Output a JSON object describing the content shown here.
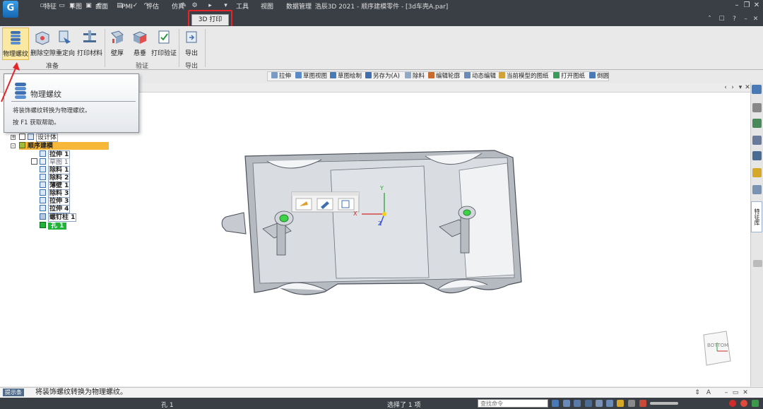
{
  "window": {
    "title": "浩辰3D 2021 - 顺序建模零件 - [3d车壳A.par]",
    "logo_letter": "G"
  },
  "tabs": [
    {
      "label": "特征",
      "active": false
    },
    {
      "label": "草图",
      "active": false
    },
    {
      "label": "曲面",
      "active": false
    },
    {
      "label": "PMI",
      "active": false
    },
    {
      "label": "评估",
      "active": false
    },
    {
      "label": "仿真",
      "active": false
    },
    {
      "label": "3D 打印",
      "active": true
    },
    {
      "label": "工具",
      "active": false
    },
    {
      "label": "视图",
      "active": false
    },
    {
      "label": "数据管理",
      "active": false
    }
  ],
  "ribbon": {
    "groups": [
      {
        "label": "准备",
        "buttons": [
          "物理螺纹",
          "删除空隙",
          "重定向",
          "打印材料"
        ]
      },
      {
        "label": "验证",
        "buttons": [
          "壁厚",
          "悬垂",
          "打印验证"
        ]
      },
      {
        "label": "导出",
        "buttons": [
          "导出"
        ]
      }
    ]
  },
  "tooltip": {
    "title": "物理螺纹",
    "description": "将装饰螺纹转换为物理螺纹。",
    "help": "按 F1 获取帮助。"
  },
  "command_bar": [
    "拉伸",
    "草图视图",
    "草图绘制",
    "另存为(A)",
    "除料",
    "编辑轮廓",
    "动态编辑",
    "当前模型的图纸",
    "打开图纸",
    "倒圆"
  ],
  "tree": {
    "design_body": "设计体",
    "root": "顺序建模",
    "features": [
      "拉伸 1",
      "草图 1",
      "除料 1",
      "除料 2",
      "薄壁 1",
      "除料 3",
      "拉伸 3",
      "拉伸 4",
      "螺钉柱 1",
      "孔 1"
    ]
  },
  "axes": {
    "x": "X",
    "y": "Y",
    "z": "Z"
  },
  "view_cube": {
    "label": "BOTTOM"
  },
  "right_panel": {
    "feature_tab": "特征库"
  },
  "prompt": {
    "label": "提示条",
    "text": "将装饰螺纹转换为物理螺纹。"
  },
  "status": {
    "left": "孔 1",
    "mid": "选择了 1 项",
    "search_placeholder": "查找命令"
  },
  "colors": {
    "title_bar": "#3a3f45",
    "active_tab_highlight": "#e4252a",
    "selected_button": "#fbe9a3",
    "tree_root_highlight": "#f7b83a",
    "tree_selected": "#1fb33a",
    "hole_green": "#3fd14a"
  }
}
